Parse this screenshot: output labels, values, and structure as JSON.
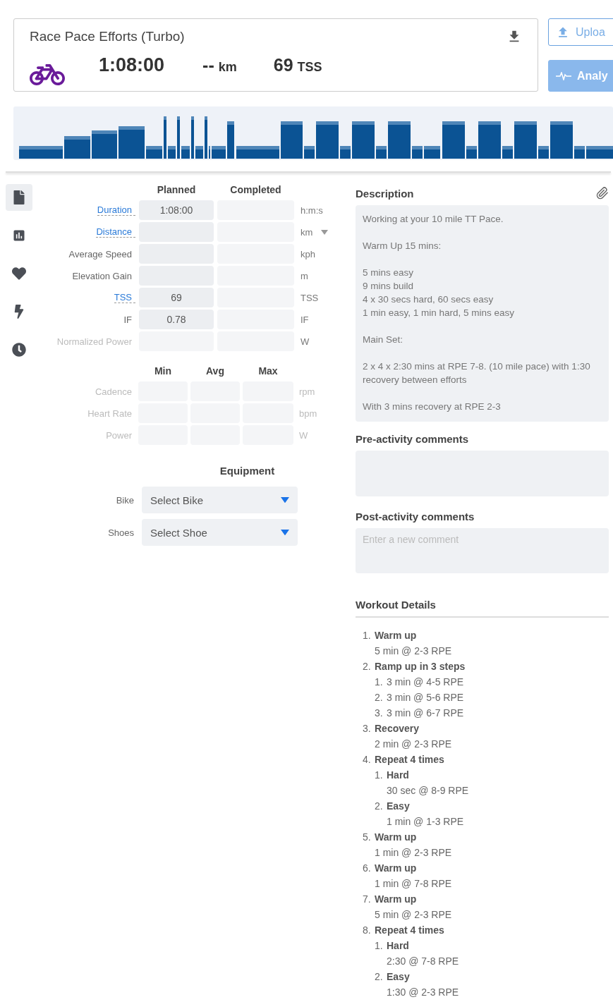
{
  "header": {
    "title": "Race Pace Efforts (Turbo)",
    "duration": "1:08:00",
    "distance": "--",
    "distance_unit": "km",
    "tss": "69",
    "tss_unit": "TSS"
  },
  "actions": [
    {
      "kind": "upload",
      "label": "Uploa"
    },
    {
      "kind": "analyze",
      "label": "Analy"
    }
  ],
  "sidebar_tabs": [
    {
      "kind": "document",
      "selected": true
    },
    {
      "kind": "chart",
      "selected": false
    },
    {
      "kind": "heart",
      "selected": false
    },
    {
      "kind": "bolt",
      "selected": false
    },
    {
      "kind": "clock",
      "selected": false
    }
  ],
  "metrics": {
    "columns": [
      "Planned",
      "Completed"
    ],
    "rows": [
      {
        "label": "Duration",
        "link": true,
        "planned": "1:08:00",
        "unit": "h:m:s",
        "unit_dropdown": false
      },
      {
        "label": "Distance",
        "link": true,
        "unit": "km",
        "unit_dropdown": true
      },
      {
        "label": "Average Speed",
        "link": false,
        "unit": "kph",
        "unit_dropdown": false
      },
      {
        "label": "Elevation Gain",
        "link": false,
        "unit": "m",
        "unit_dropdown": false
      },
      {
        "label": "TSS",
        "link": true,
        "planned": "69",
        "unit": "TSS",
        "unit_dropdown": false
      },
      {
        "label": "IF",
        "link": false,
        "planned": "0.78",
        "unit": "IF",
        "unit_dropdown": false
      },
      {
        "label": "Normalized Power",
        "link": false,
        "disabled": true,
        "unit": "W",
        "unit_dropdown": false
      }
    ]
  },
  "ranges": {
    "columns": [
      "Min",
      "Avg",
      "Max"
    ],
    "rows": [
      {
        "label": "Cadence",
        "unit": "rpm",
        "disabled": true
      },
      {
        "label": "Heart Rate",
        "unit": "bpm",
        "disabled": true
      },
      {
        "label": "Power",
        "unit": "W",
        "disabled": true
      }
    ]
  },
  "equipment": {
    "title": "Equipment",
    "fields": [
      {
        "label": "Bike",
        "value": "Select Bike"
      },
      {
        "label": "Shoes",
        "value": "Select Shoe"
      }
    ]
  },
  "description": {
    "title": "Description",
    "paragraphs": [
      "Working at your 10 mile TT Pace.",
      "Warm Up 15 mins:",
      "5 mins easy\n9 mins build\n4 x 30 secs hard, 60 secs easy\n1 min easy, 1 min hard, 5 mins easy",
      "Main Set:",
      "2 x 4 x 2:30 mins at RPE 7-8. (10 mile pace) with 1:30 recovery between efforts",
      "With 3 mins recovery at RPE 2-3"
    ]
  },
  "pre_activity_comments": {
    "title": "Pre-activity comments"
  },
  "post_activity_comments": {
    "title": "Post-activity comments",
    "placeholder": "Enter a new comment"
  },
  "workout_details": {
    "title": "Workout Details",
    "steps": [
      {
        "number": "1.",
        "title": "Warm up",
        "detail": "5 min @ 2-3 RPE"
      },
      {
        "number": "2.",
        "title": "Ramp up in 3 steps",
        "children": [
          {
            "number": "1.",
            "detail": "3 min @ 4-5 RPE"
          },
          {
            "number": "2.",
            "detail": "3 min @ 5-6 RPE"
          },
          {
            "number": "3.",
            "detail": "3 min @ 6-7 RPE"
          }
        ]
      },
      {
        "number": "3.",
        "title": "Recovery",
        "detail": "2 min @ 2-3 RPE"
      },
      {
        "number": "4.",
        "title": "Repeat 4 times",
        "children": [
          {
            "number": "1.",
            "title": "Hard",
            "detail": "30 sec @ 8-9 RPE"
          },
          {
            "number": "2.",
            "title": "Easy",
            "detail": "1 min @ 1-3 RPE"
          }
        ]
      },
      {
        "number": "5.",
        "title": "Warm up",
        "detail": "1 min @ 2-3 RPE"
      },
      {
        "number": "6.",
        "title": "Warm up",
        "detail": "1 min @ 7-8 RPE"
      },
      {
        "number": "7.",
        "title": "Warm up",
        "detail": "5 min @ 2-3 RPE"
      },
      {
        "number": "8.",
        "title": "Repeat 4 times",
        "children": [
          {
            "number": "1.",
            "title": "Hard",
            "detail": "2:30 @ 7-8 RPE"
          },
          {
            "number": "2.",
            "title": "Easy",
            "detail": "1:30 @ 2-3 RPE"
          }
        ]
      }
    ]
  }
}
